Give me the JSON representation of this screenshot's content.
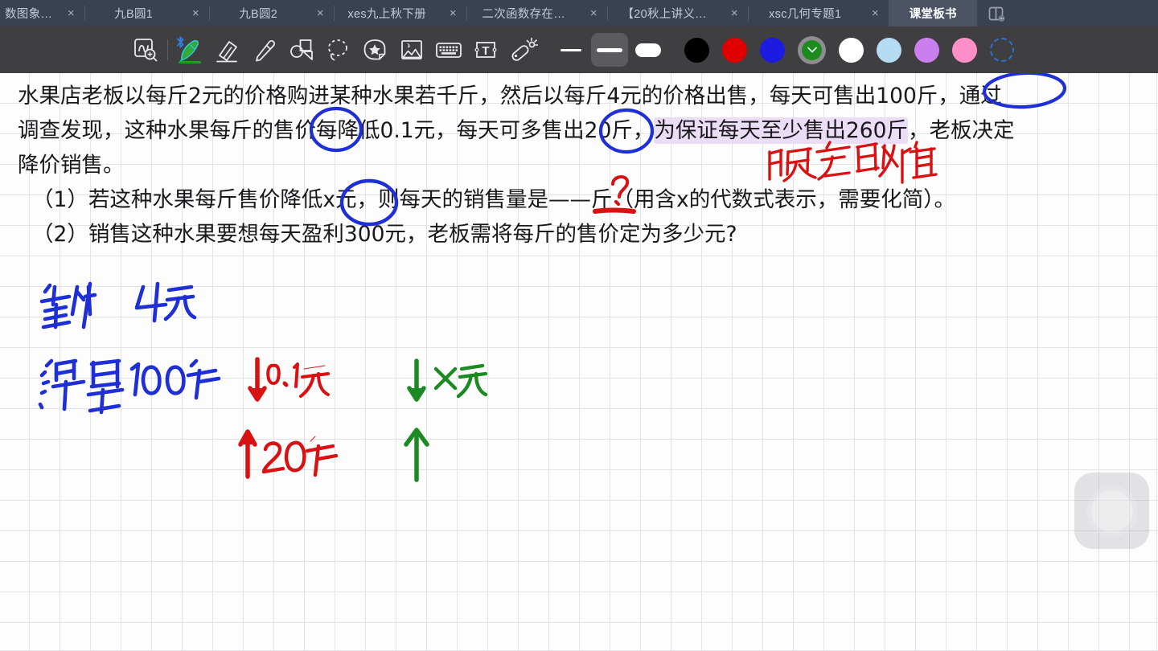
{
  "window": {
    "tabs": [
      {
        "label": "数图象…",
        "active": false,
        "closable": true
      },
      {
        "label": "九B圆1",
        "active": false,
        "closable": true
      },
      {
        "label": "九B圆2",
        "active": false,
        "closable": true
      },
      {
        "label": "xes九上秋下册",
        "active": false,
        "closable": true
      },
      {
        "label": "二次函数存在…",
        "active": false,
        "closable": true
      },
      {
        "label": "【20秋上讲义…",
        "active": false,
        "closable": true
      },
      {
        "label": "xsc几何专题1",
        "active": false,
        "closable": true
      },
      {
        "label": "课堂板书",
        "active": true,
        "closable": false
      }
    ],
    "close_glyph": "×",
    "overview_icon": "split-view-icon",
    "tabbar_bg": "#3a4251",
    "active_tab_bg": "#4a5263"
  },
  "toolbar": {
    "bg": "#3f3f41",
    "tools": [
      {
        "name": "zoom-annotate-tool",
        "label": "放大批注",
        "selected": false
      },
      {
        "name": "pen-tool",
        "label": "钢笔",
        "selected": true,
        "bluetooth": true,
        "color": "#2faa3c"
      },
      {
        "name": "eraser-tool",
        "label": "橡皮擦",
        "selected": false
      },
      {
        "name": "highlighter-tool",
        "label": "荧光笔",
        "selected": false
      },
      {
        "name": "shapes-tool",
        "label": "形状",
        "selected": false
      },
      {
        "name": "lasso-select-tool",
        "label": "套索选择",
        "selected": false
      },
      {
        "name": "sticker-tool",
        "label": "贴纸",
        "selected": false
      },
      {
        "name": "image-tool",
        "label": "图片",
        "selected": false
      },
      {
        "name": "keyboard-tool",
        "label": "键盘",
        "selected": false
      },
      {
        "name": "textbox-tool",
        "label": "文本框",
        "selected": false
      },
      {
        "name": "laser-pointer-tool",
        "label": "激光笔",
        "selected": false
      }
    ],
    "stroke_widths": [
      {
        "name": "stroke-width-thin",
        "size": "细",
        "active": false
      },
      {
        "name": "stroke-width-medium",
        "size": "中",
        "active": true
      },
      {
        "name": "stroke-width-thick",
        "size": "粗",
        "active": false
      }
    ],
    "colors": [
      {
        "name": "color-black",
        "hex": "#000000",
        "selected": false
      },
      {
        "name": "color-red",
        "hex": "#e00000",
        "selected": false
      },
      {
        "name": "color-blue",
        "hex": "#1b1be2",
        "selected": false
      },
      {
        "name": "color-green",
        "hex": "#1d8a1f",
        "selected": true
      },
      {
        "name": "color-white",
        "hex": "#ffffff",
        "selected": false
      },
      {
        "name": "color-light-blue",
        "hex": "#b5dcf2",
        "selected": false
      },
      {
        "name": "color-orchid",
        "hex": "#cb7fee",
        "selected": false
      },
      {
        "name": "color-pink",
        "hex": "#ff8fc8",
        "selected": false
      },
      {
        "name": "color-custom",
        "hex": "#2f6fd0",
        "selected": false,
        "custom": true
      }
    ],
    "selected_color_check": "⌄"
  },
  "canvas": {
    "grid_color": "#e3e3e6",
    "grid_size_px": 38,
    "background": "#fdfdfe",
    "document": {
      "body_line1": "水果店老板以每斤2元的价格购进某种水果若千斤，然后以每斤4元的价格出售，每天可售出100斤，通过",
      "body_line2_a": "调查发现，这种水果每斤的售价每降低0.1元，每天可多售出20斤，",
      "body_line2_highlight": "为保证每天至少售出260斤",
      "body_line2_b": "，老板决定",
      "body_line3": "降价销售。",
      "question1": "（1）若这种水果每斤售价降低x元，则每天的销售量是——斤（用含x的代数式表示，需要化简）。",
      "question2": "（2）销售这种水果要想每天盈利300元，老板需将每斤的售价定为多少元?"
    },
    "annotations": {
      "circle_shoujia": {
        "text": "售价",
        "color": "#1f2fd6",
        "shape": "ellipse"
      },
      "circle_100jin": {
        "text": "100斤",
        "color": "#1f2fd6",
        "shape": "ellipse"
      },
      "circle_duoshouchu": {
        "text": "多售出",
        "color": "#1f2fd6",
        "shape": "ellipse"
      },
      "circle_xyuan": {
        "text": "x元，",
        "color": "#1f2fd6",
        "shape": "ellipse"
      },
      "highlight_260": {
        "text": "为保证每天至少售出260斤",
        "color": "#ecddf7"
      },
      "red_note": {
        "text": "限定取值",
        "color": "#d81212"
      },
      "red_question_mark": {
        "text": "?",
        "color": "#d81212"
      },
      "table": {
        "rows": [
          {
            "label": "售价",
            "value": "4元",
            "red_change": "↓0.1元",
            "green_change": "↓x元"
          },
          {
            "label": "销量",
            "value": "100斤",
            "red_change": "↑20斤",
            "green_change": "↑"
          }
        ],
        "label_color": "#1f2fd6",
        "red_color": "#d81212",
        "green_color": "#1c8a22"
      }
    },
    "floating_button": {
      "name": "assistive-touch-button",
      "label": "悬浮球"
    }
  }
}
